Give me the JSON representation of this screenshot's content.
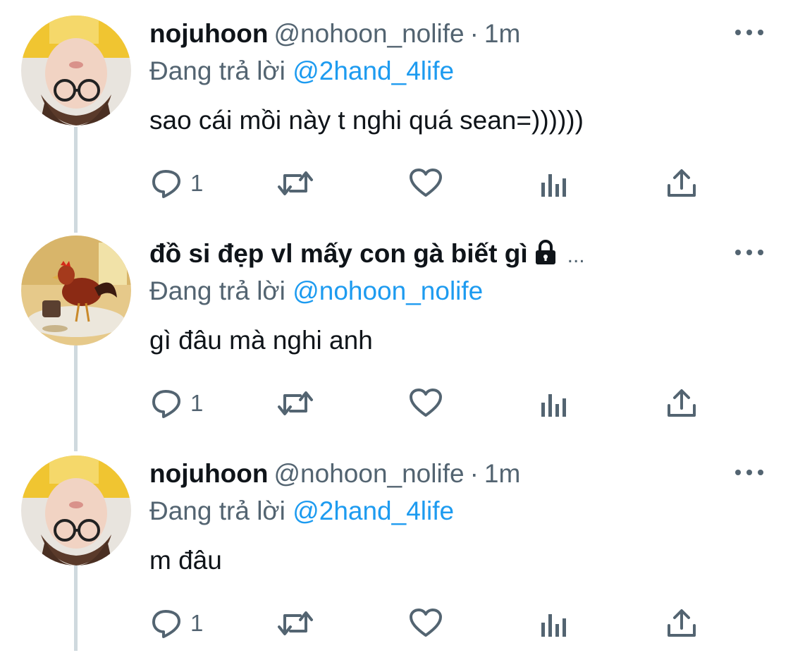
{
  "tweets": [
    {
      "display_name": "nojuhoon",
      "handle": "@nohoon_nolife",
      "separator": "·",
      "time": "1m",
      "replying_prefix": "Đang trả lời",
      "replying_to": "@2hand_4life",
      "text": "sao cái mồi này t nghi quá sean=))))))",
      "reply_count": "1",
      "avatar": "person-with-glasses-avatar"
    },
    {
      "display_name": "đồ si đẹp vl mấy con gà biết gì",
      "locked_icon": "lock-icon",
      "truncation": "...",
      "replying_prefix": "Đang trả lời",
      "replying_to": "@nohoon_nolife",
      "text": "gì đâu mà nghi anh",
      "reply_count": "1",
      "avatar": "rooster-avatar"
    },
    {
      "display_name": "nojuhoon",
      "handle": "@nohoon_nolife",
      "separator": "·",
      "time": "1m",
      "replying_prefix": "Đang trả lời",
      "replying_to": "@2hand_4life",
      "text": "m đâu",
      "reply_count": "1",
      "avatar": "person-with-glasses-avatar"
    }
  ],
  "colors": {
    "text": "#0f1419",
    "secondary": "#536471",
    "mention": "#1d9bf0",
    "thread_line": "#cfd9de"
  }
}
